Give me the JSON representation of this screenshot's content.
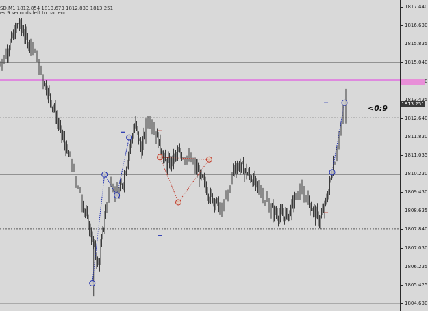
{
  "chart_info": {
    "line1": "SD,M1  1812.854 1813.673 1812.833 1813.251",
    "line2": "es 9 seconds left to bar end"
  },
  "countdown": "<0:9",
  "bid_price_label": "1813.251",
  "colors": {
    "background": "#d9d9d9",
    "candles": "#3b3b3b",
    "alert_line": "#e070e0",
    "solid_levels": "#7a7a7a",
    "dotted_levels": "#5a5a5a",
    "pattern_blue": "#1f2fb0",
    "pattern_red": "#c0392b"
  },
  "chart_data": {
    "type": "line",
    "series": [
      {
        "values": [
          1814.9,
          1815.45,
          1816.1,
          1816.75,
          1816.25,
          1815.75,
          1815.2,
          1814.3,
          1813.6,
          1812.8,
          1811.95,
          1811.1,
          1810.3,
          1809.4,
          1808.4,
          1807.4,
          1806.2,
          1808.3,
          1810.1,
          1809.2,
          1809.9,
          1811.3,
          1812.4,
          1811.2,
          1812.6,
          1812.3,
          1811.4,
          1810.6,
          1810.8,
          1811.1,
          1811.0,
          1810.8,
          1810.4,
          1809.9,
          1809.3,
          1809.1,
          1808.6,
          1809.3,
          1810.5,
          1810.6,
          1810.3,
          1810.0,
          1809.6,
          1809.2,
          1808.7,
          1808.5,
          1808.4,
          1808.5,
          1809.2,
          1809.5,
          1809.1,
          1808.6,
          1808.2,
          1809.0,
          1810.3,
          1811.6,
          1813.3
        ]
      }
    ],
    "ylim": [
      1804.63,
      1817.44
    ],
    "y_ticks": [
      "1817.440",
      "1816.630",
      "1815.835",
      "1815.040",
      "1814.230",
      "1813.435",
      "1812.640",
      "1811.830",
      "1811.035",
      "1810.230",
      "1809.430",
      "1808.635",
      "1807.840",
      "1807.030",
      "1806.235",
      "1805.425",
      "1804.630"
    ],
    "grid": false,
    "levels": {
      "solid": [
        1815.04,
        1810.2,
        1804.63
      ],
      "dotted": [
        1812.65,
        1807.85
      ],
      "alert": 1814.28
    },
    "pattern_blue": [
      {
        "i": 15,
        "y": 1805.5
      },
      {
        "i": 17,
        "y": 1810.2
      },
      {
        "i": 19,
        "y": 1809.3
      },
      {
        "i": 21,
        "y": 1811.8
      },
      {
        "i": 54,
        "y": 1810.3
      },
      {
        "i": 56,
        "y": 1813.3
      }
    ],
    "pattern_red": [
      {
        "i": 26,
        "y": 1810.95
      },
      {
        "i": 29,
        "y": 1809.0
      },
      {
        "i": 34,
        "y": 1810.85
      }
    ],
    "dash_markers": [
      {
        "i": 20,
        "y": 1812.03,
        "color": "blue"
      },
      {
        "i": 26,
        "y": 1812.09,
        "color": "red"
      },
      {
        "i": 26,
        "y": 1807.56,
        "color": "blue"
      },
      {
        "i": 53,
        "y": 1813.3,
        "color": "blue"
      },
      {
        "i": 53,
        "y": 1808.55,
        "color": "red"
      }
    ]
  }
}
